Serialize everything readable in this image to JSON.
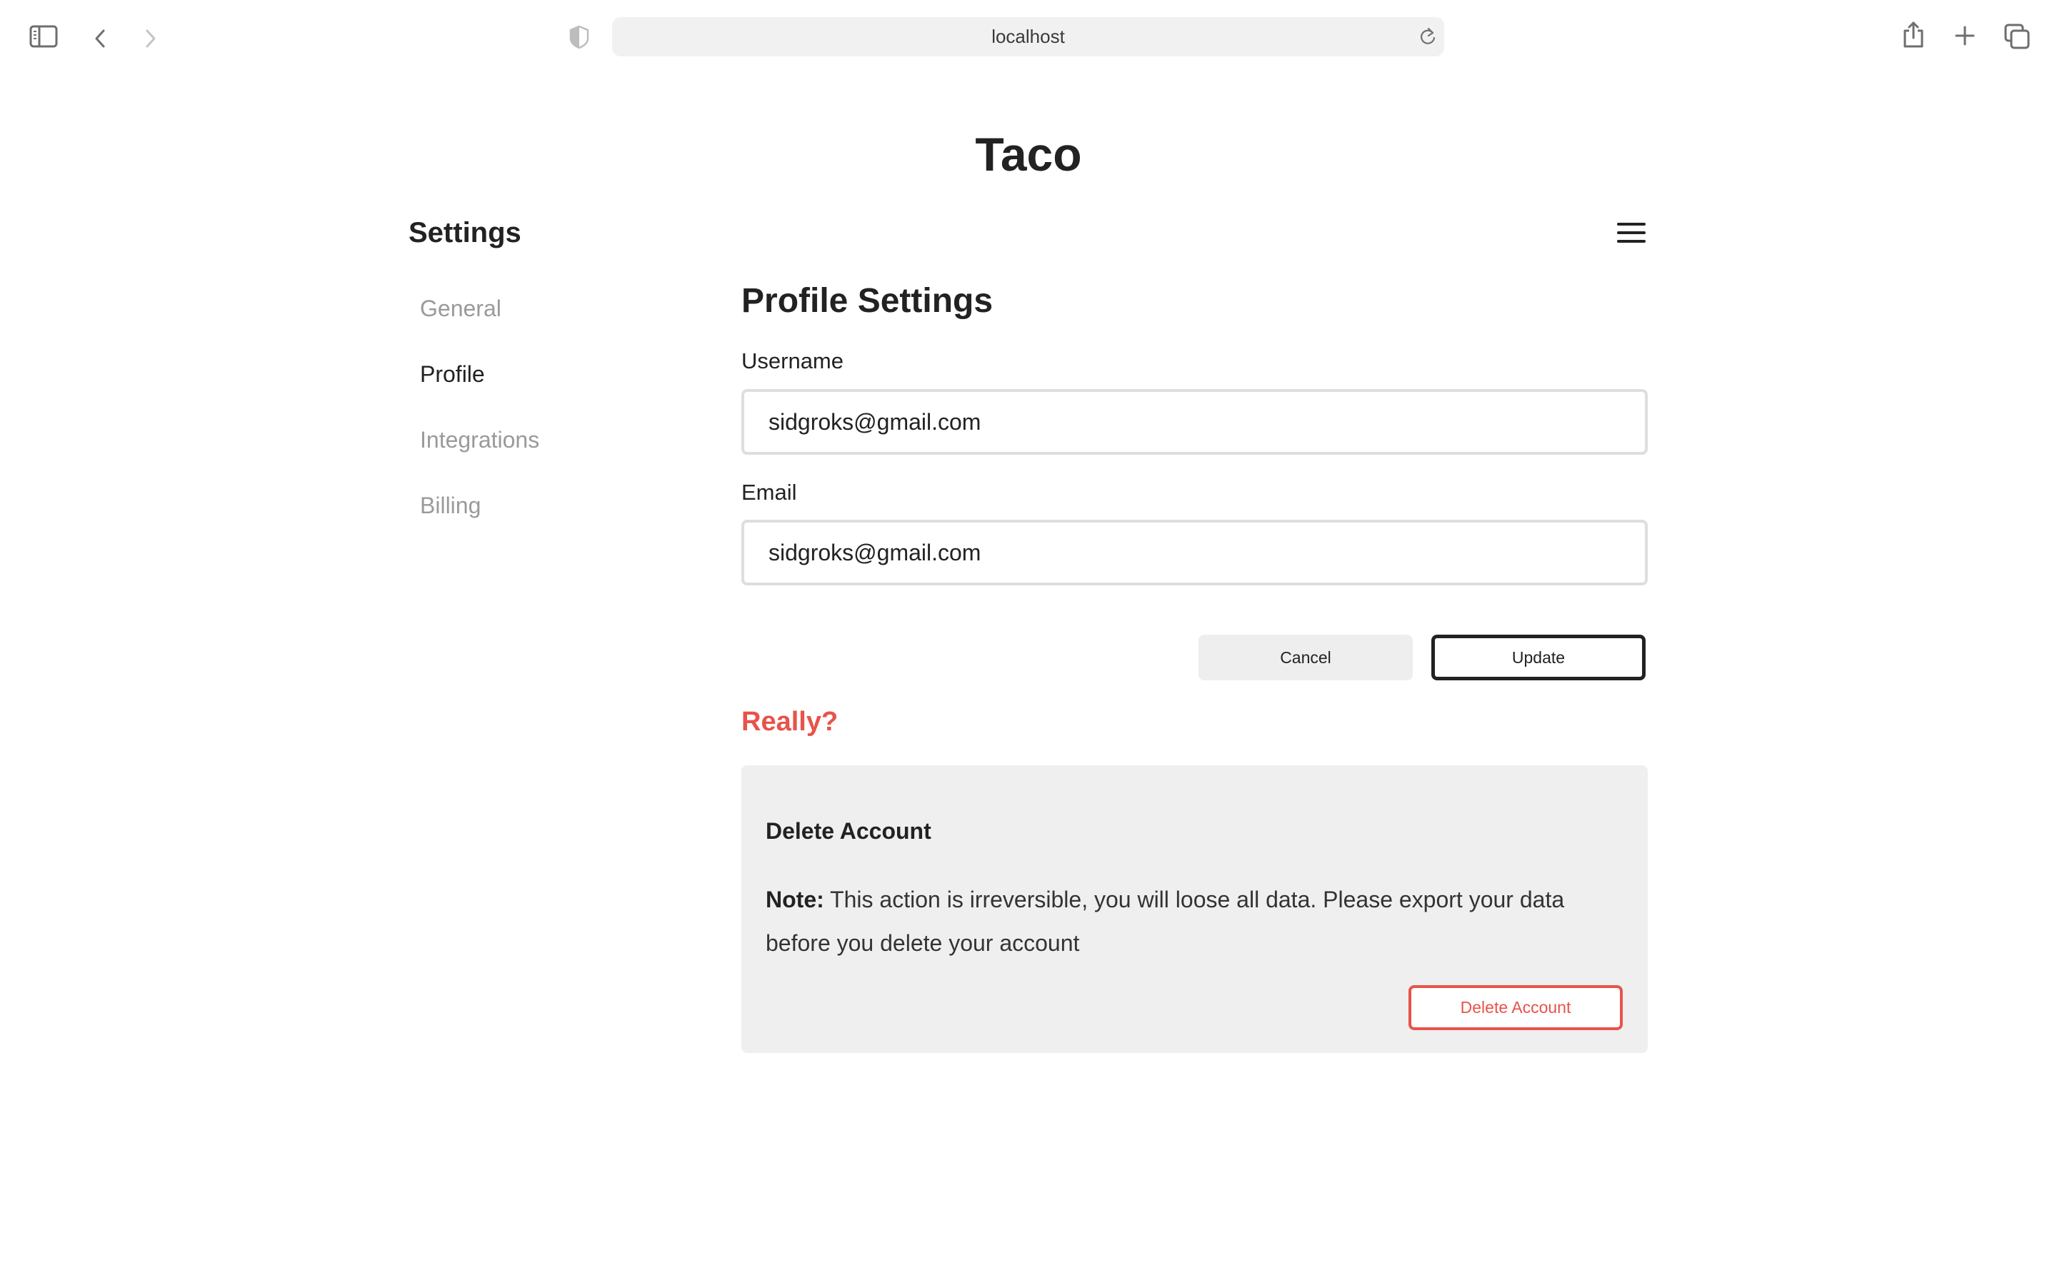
{
  "browser": {
    "url": "localhost",
    "icons": {
      "sidebar": "sidebar-toggle-icon",
      "back": "chevron-left-icon",
      "forward": "chevron-right-icon",
      "privacy": "shield-icon",
      "reload": "reload-icon",
      "share": "share-icon",
      "new_tab": "plus-icon",
      "tabs": "tab-overview-icon"
    }
  },
  "app": {
    "title": "Taco",
    "menu_icon": "hamburger-menu-icon"
  },
  "sidebar": {
    "heading": "Settings",
    "items": [
      {
        "label": "General",
        "active": false
      },
      {
        "label": "Profile",
        "active": true
      },
      {
        "label": "Integrations",
        "active": false
      },
      {
        "label": "Billing",
        "active": false
      }
    ]
  },
  "profile": {
    "title": "Profile Settings",
    "username_label": "Username",
    "username_value": "sidgroks@gmail.com",
    "email_label": "Email",
    "email_value": "sidgroks@gmail.com",
    "cancel_label": "Cancel",
    "update_label": "Update"
  },
  "danger": {
    "heading": "Really?",
    "title": "Delete Account",
    "note_label": "Note:",
    "note_text": " This action is irreversible, you will loose all data. Please export your data before you delete your account",
    "delete_label": "Delete Account",
    "accent_color": "#e8534a"
  }
}
